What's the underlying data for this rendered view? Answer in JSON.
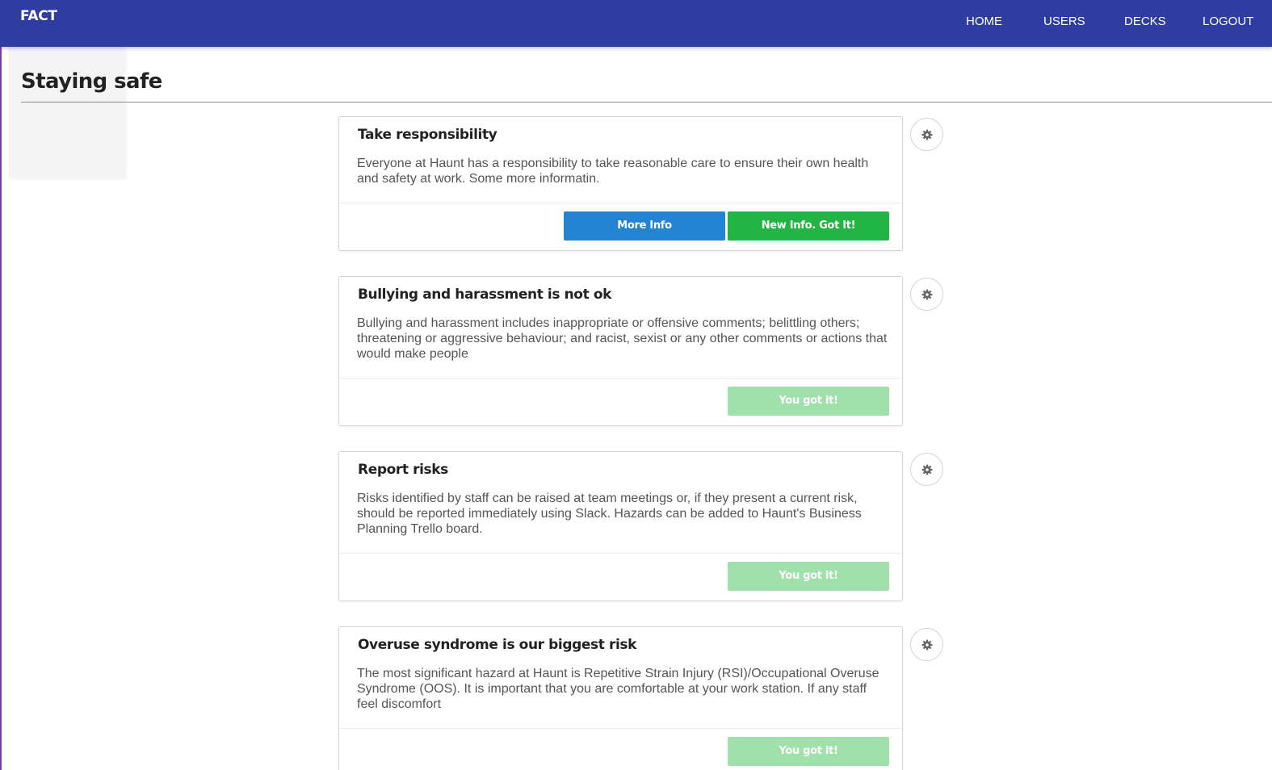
{
  "app": {
    "brand": "FACT"
  },
  "nav": {
    "items": [
      {
        "label": "HOME"
      },
      {
        "label": "USERS"
      },
      {
        "label": "DECKS"
      },
      {
        "label": "LOGOUT"
      }
    ]
  },
  "page": {
    "title": "Staying safe"
  },
  "cards": [
    {
      "title": "Take responsibility",
      "text": "Everyone at Haunt has a responsibility to take reasonable care to ensure their own health and safety at work. Some more informatin.",
      "more_info_label": "More Info",
      "got_it_label": "New Info. Got It!"
    },
    {
      "title": "Bullying and harassment is not ok",
      "text": "Bullying and harassment includes inappropriate or offensive comments; belittling others; threatening or aggressive behaviour; and racist, sexist or any other comments or actions that would make people",
      "got_it_label": "You got it!"
    },
    {
      "title": "Report risks",
      "text": "Risks identified by staff can be raised at team meetings or, if they present a current risk, should be reported immediately using Slack. Hazards can be added to Haunt's Business Planning Trello board.",
      "got_it_label": "You got it!"
    },
    {
      "title": "Overuse syndrome is our biggest risk",
      "text": "The most significant hazard at Haunt is Repetitive Strain Injury (RSI)/Occupational Overuse Syndrome (OOS). It is important that you are comfortable at your work station. If any staff feel discomfort",
      "got_it_label": "You got it!"
    }
  ],
  "colors": {
    "navbar": "#2f3ca0",
    "more_info_button": "#2384d2",
    "got_it_button": "#22b543",
    "acknowledged_button": "#9fe0ab"
  },
  "icons": {
    "card_settings": "gear-icon"
  }
}
